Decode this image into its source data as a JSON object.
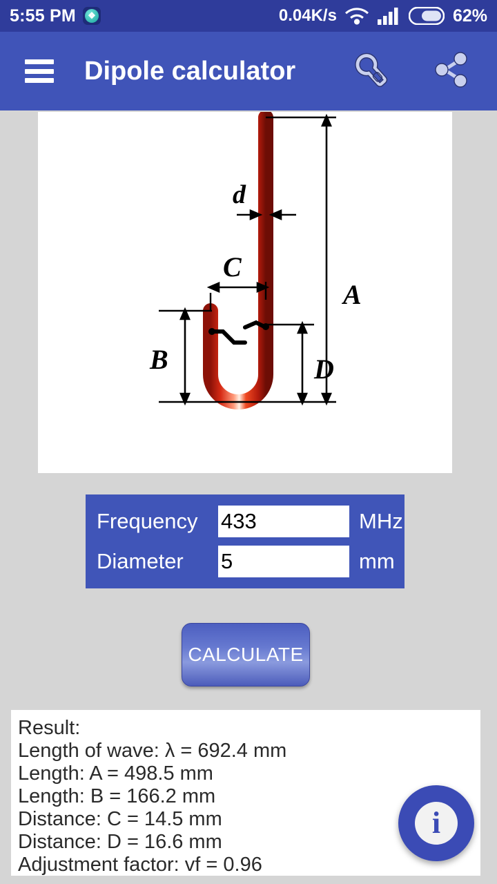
{
  "status_bar": {
    "time": "5:55 PM",
    "app_badge_icon": "app-badge-icon",
    "net_speed": "0.04K/s",
    "wifi_icon": "wifi-icon",
    "signal_icon": "cellular-signal-icon",
    "battery_icon": "battery-icon",
    "battery_percent": "62%",
    "background_color": "#2f3c9b"
  },
  "app_bar": {
    "menu_icon": "hamburger-menu-icon",
    "title": "Dipole calculator",
    "settings_icon": "wrench-icon",
    "share_icon": "share-icon",
    "background_color": "#4054b8"
  },
  "diagram": {
    "alt": "Folded dipole J-pole antenna dimension diagram",
    "labels": {
      "d": "d",
      "C": "C",
      "A": "A",
      "B": "B",
      "D": "D"
    },
    "colors": {
      "tube": "#cc2010",
      "tube_highlight": "#ffd9c0",
      "feedline": "#4a4a93",
      "dimension_line": "#000000",
      "panel_background": "#ffffff"
    }
  },
  "inputs": {
    "panel_color": "#4055b8",
    "frequency": {
      "label": "Frequency",
      "value": "433",
      "placeholder": "",
      "unit": "MHz"
    },
    "diameter": {
      "label": "Diameter",
      "value": "5",
      "placeholder": "",
      "unit": "mm"
    }
  },
  "calculate_button": {
    "label": "CALCULATE"
  },
  "result": {
    "lines": [
      "Result:",
      "Length of wave: λ = 692.4 mm",
      "Length: A = 498.5 mm",
      "Length: B = 166.2 mm",
      "Distance: C = 14.5 mm",
      "Distance: D = 16.6 mm",
      "Adjustment factor: vf = 0.96"
    ]
  },
  "fab": {
    "icon": "info-icon",
    "glyph": "i",
    "color": "#3b4bb5"
  }
}
